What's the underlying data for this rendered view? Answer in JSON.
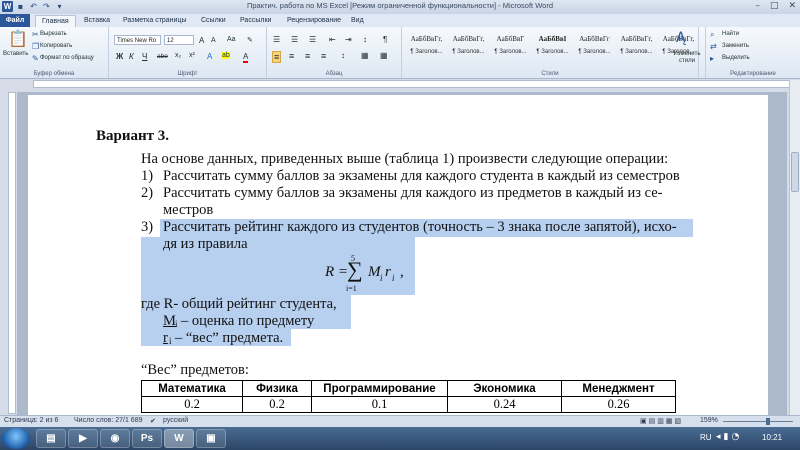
{
  "app": {
    "title": "Практич. работа по MS Excel [Режим ограниченной функциональности] - Microsoft Word",
    "logo_letter": "W",
    "window_controls": [
      "–",
      "□",
      "✕"
    ]
  },
  "quick_access": {
    "items": [
      "save-icon",
      "undo-icon",
      "redo-icon",
      "customize-icon"
    ],
    "glyphs": [
      "▪",
      "↶",
      "↷",
      "▾"
    ]
  },
  "tabs": {
    "file": "Файл",
    "items": [
      "Главная",
      "Вставка",
      "Разметка страницы",
      "Ссылки",
      "Рассылки",
      "Рецензирование",
      "Вид"
    ],
    "active_index": 0
  },
  "ribbon": {
    "clipboard": {
      "group_label": "Буфер обмена",
      "paste": "Вставить",
      "cut": "Вырезать",
      "copy": "Копировать",
      "format_painter": "Формат по образцу"
    },
    "font": {
      "group_label": "Шрифт",
      "font_name": "Times New Ro",
      "font_size": "12",
      "grow": "A",
      "shrink": "A",
      "case": "Aa",
      "clear": "✎",
      "bold": "Ж",
      "italic": "К",
      "underline": "Ч",
      "strike": "abe",
      "subscript": "x₂",
      "superscript": "x²",
      "effects": "A",
      "highlight": "ab",
      "color": "A"
    },
    "paragraph": {
      "group_label": "Абзац",
      "row1": [
        "☰",
        "☰",
        "☰",
        "⇤",
        "⇥",
        "↕",
        "¶"
      ],
      "row2": [
        "≡",
        "≡",
        "≡",
        "≡",
        "↕",
        "▦",
        "▦"
      ]
    },
    "styles": {
      "group_label": "Стили",
      "items": [
        {
          "preview": "АаБбВвГг,",
          "name": "¶ Заголов..."
        },
        {
          "preview": "АаБбВвГг,",
          "name": "¶ Заголов..."
        },
        {
          "preview": "АаБбВвГ",
          "name": "¶ Заголов..."
        },
        {
          "preview": "АаБбВвI",
          "name": "¶ Заголов..."
        },
        {
          "preview": "АаБбВвГг",
          "name": "¶ Заголов..."
        },
        {
          "preview": "АаБбВвГг,",
          "name": "¶ Заголов..."
        },
        {
          "preview": "АаБбВвГг,",
          "name": "¶ Заголов..."
        }
      ],
      "change": "Изменить стили"
    },
    "editing": {
      "group_label": "Редактирование",
      "find": "Найти",
      "replace": "Заменить",
      "select": "Выделить"
    }
  },
  "document": {
    "heading": "Вариант 3.",
    "intro": "На основе данных, приведенных выше (таблица 1) произвести следующие операции:",
    "items": [
      {
        "num": "1)",
        "lines": [
          "Рассчитать сумму баллов за экзамены для каждого студента в каждый из семестров"
        ]
      },
      {
        "num": "2)",
        "lines": [
          "Рассчитать сумму баллов за экзамены для каждого из предметов в каждый из се-",
          "местров"
        ]
      },
      {
        "num": "3)",
        "lines": [
          "Рассчитать рейтинг каждого из студентов (точность – 3 знака после запятой), исхо-",
          "дя из правила"
        ]
      }
    ],
    "formula": {
      "lhs": "R =",
      "sigma": "∑",
      "upper": "5",
      "lower": "i=1",
      "term_m": "M",
      "term_r": "r",
      "sub": "i",
      "tail": ","
    },
    "where_lines": [
      "где R- общий рейтинг студента,",
      "M",
      "– оценка по предмету",
      "r",
      "– “вес” предмета."
    ],
    "weights_label": "“Вес” предметов:",
    "table": {
      "headers": [
        "Математика",
        "Физика",
        "Программирование",
        "Экономика",
        "Менеджмент"
      ],
      "values": [
        "0.2",
        "0.2",
        "0.1",
        "0.24",
        "0.26"
      ]
    }
  },
  "status_bar": {
    "page": "Страница: 2 из 6",
    "words": "Число слов: 27/1 689",
    "language": "русский",
    "zoom": "159%"
  },
  "taskbar": {
    "buttons": [
      "explorer",
      "media",
      "chrome",
      "photoshop",
      "word",
      "unknown"
    ],
    "labels": [
      "▤",
      "▶",
      "◉",
      "Ps",
      "W",
      "▣"
    ],
    "active_index": 4,
    "lang": "RU",
    "time": "10:21"
  },
  "colors": {
    "selection": "#b7d0f0",
    "file_tab": "#2b579a",
    "taskbar": "#2b4566"
  }
}
